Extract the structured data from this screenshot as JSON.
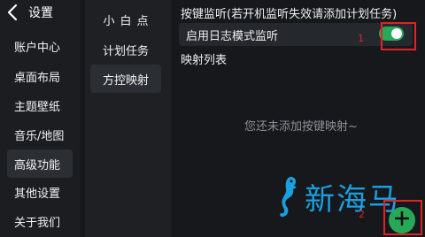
{
  "header": {
    "title": "设置"
  },
  "sidebar": {
    "items": [
      {
        "label": "账户中心"
      },
      {
        "label": "桌面布局"
      },
      {
        "label": "主题壁纸"
      },
      {
        "label": "音乐/地图"
      },
      {
        "label": "高级功能",
        "active": true
      },
      {
        "label": "其他设置"
      },
      {
        "label": "关于我们"
      }
    ]
  },
  "subnav": {
    "items": [
      {
        "label": "小白点"
      },
      {
        "label": "计划任务"
      },
      {
        "label": "方控映射",
        "active": true
      }
    ]
  },
  "main": {
    "key_listen_title": "按键监听(若开机监听失效请添加计划任务)",
    "log_mode": {
      "label": "启用日志模式监听",
      "enabled": true
    },
    "mapping_list_title": "映射列表",
    "empty_text": "您还未添加按键映射~",
    "marker_1": "1",
    "marker_2": "2"
  },
  "watermark": {
    "text": "新海马"
  },
  "colors": {
    "accent_green": "#27a85a",
    "annotation_red": "#e02424",
    "watermark_blue": "#1aa0e0"
  },
  "icons": {
    "back": "chevron-left-icon",
    "add": "plus-icon",
    "watermark_logo": "seahorse-icon"
  }
}
